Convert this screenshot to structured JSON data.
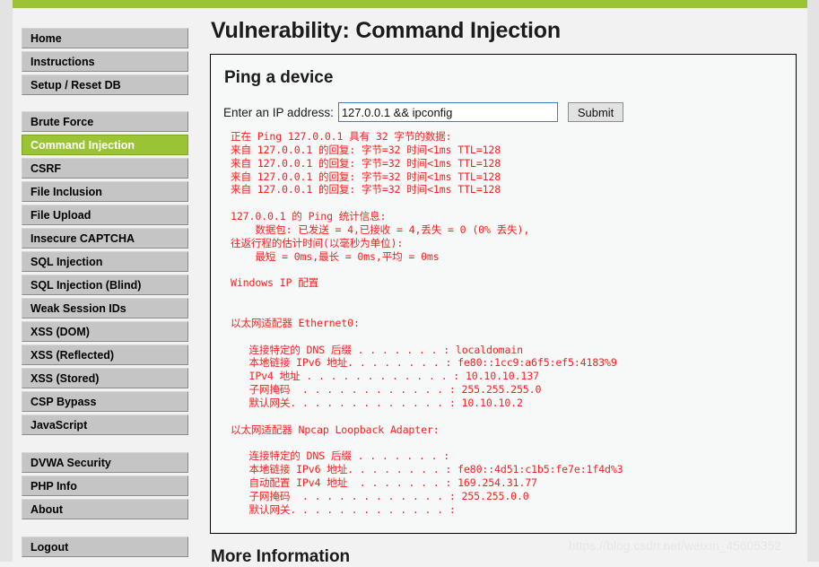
{
  "theme": {
    "accent_green": "#9ac435",
    "output_red": "#fa2020",
    "button_gray": "#c5c5c5",
    "input_focus_blue": "#3f7fbf"
  },
  "sidebar": {
    "groups": [
      {
        "items": [
          {
            "label": "Home",
            "active": false
          },
          {
            "label": "Instructions",
            "active": false
          },
          {
            "label": "Setup / Reset DB",
            "active": false
          }
        ]
      },
      {
        "items": [
          {
            "label": "Brute Force",
            "active": false
          },
          {
            "label": "Command Injection",
            "active": true
          },
          {
            "label": "CSRF",
            "active": false
          },
          {
            "label": "File Inclusion",
            "active": false
          },
          {
            "label": "File Upload",
            "active": false
          },
          {
            "label": "Insecure CAPTCHA",
            "active": false
          },
          {
            "label": "SQL Injection",
            "active": false
          },
          {
            "label": "SQL Injection (Blind)",
            "active": false
          },
          {
            "label": "Weak Session IDs",
            "active": false
          },
          {
            "label": "XSS (DOM)",
            "active": false
          },
          {
            "label": "XSS (Reflected)",
            "active": false
          },
          {
            "label": "XSS (Stored)",
            "active": false
          },
          {
            "label": "CSP Bypass",
            "active": false
          },
          {
            "label": "JavaScript",
            "active": false
          }
        ]
      },
      {
        "items": [
          {
            "label": "DVWA Security",
            "active": false
          },
          {
            "label": "PHP Info",
            "active": false
          },
          {
            "label": "About",
            "active": false
          }
        ]
      },
      {
        "items": [
          {
            "label": "Logout",
            "active": false
          }
        ]
      }
    ]
  },
  "main": {
    "page_title": "Vulnerability: Command Injection",
    "vuln_heading": "Ping a device",
    "form": {
      "ip_label": "Enter an IP address:",
      "ip_value": "127.0.0.1 && ipconfig",
      "ip_placeholder": "",
      "submit_label": "Submit"
    },
    "command_output": "正在 Ping 127.0.0.1 具有 32 字节的数据:\n来自 127.0.0.1 的回复: 字节=32 时间<1ms TTL=128\n来自 127.0.0.1 的回复: 字节=32 时间<1ms TTL=128\n来自 127.0.0.1 的回复: 字节=32 时间<1ms TTL=128\n来自 127.0.0.1 的回复: 字节=32 时间<1ms TTL=128\n\n127.0.0.1 的 Ping 统计信息:\n    数据包: 已发送 = 4,已接收 = 4,丢失 = 0 (0% 丢失),\n往返行程的估计时间(以毫秒为单位):\n    最短 = 0ms,最长 = 0ms,平均 = 0ms\n\nWindows IP 配置\n\n\n以太网适配器 Ethernet0:\n\n   连接特定的 DNS 后缀 . . . . . . . : localdomain\n   本地链接 IPv6 地址. . . . . . . . : fe80::1cc9:a6f5:ef5:4183%9\n   IPv4 地址 . . . . . . . . . . . . : 10.10.10.137\n   子网掩码  . . . . . . . . . . . . : 255.255.255.0\n   默认网关. . . . . . . . . . . . . : 10.10.10.2\n\n以太网适配器 Npcap Loopback Adapter:\n\n   连接特定的 DNS 后缀 . . . . . . . :\n   本地链接 IPv6 地址. . . . . . . . : fe80::4d51:c1b5:fe7e:1f4d%3\n   自动配置 IPv4 地址  . . . . . . . : 169.254.31.77\n   子网掩码  . . . . . . . . . . . . : 255.255.0.0\n   默认网关. . . . . . . . . . . . . :",
    "more_information_heading": "More Information"
  },
  "watermark": {
    "text": "https://blog.csdn.net/weixin_45605352"
  }
}
